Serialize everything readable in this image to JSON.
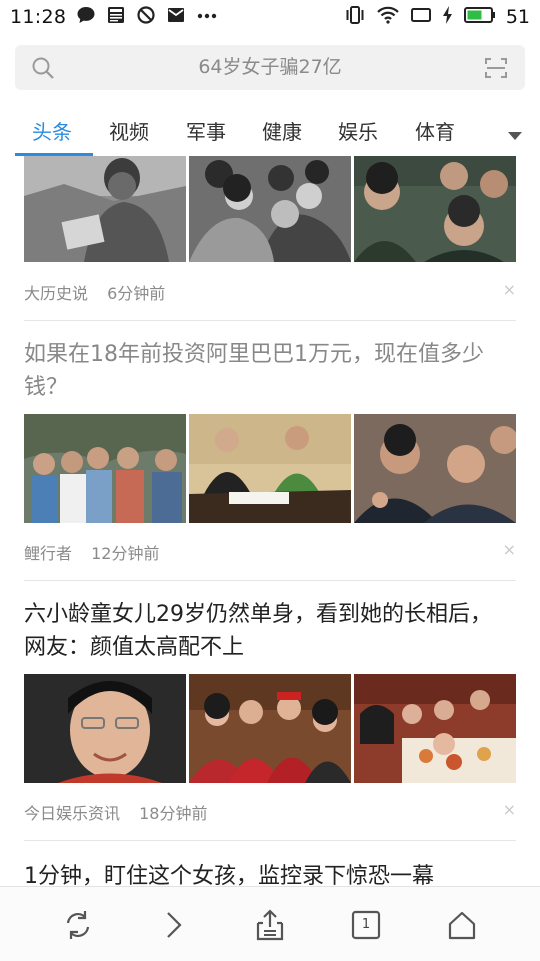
{
  "status_bar": {
    "time": "11:28",
    "battery_percent": "51",
    "left_icons": [
      "chat-icon",
      "news-icon",
      "block-icon",
      "mail-icon",
      "more-dots-icon"
    ],
    "right_icons": [
      "vibrate-icon",
      "wifi-icon",
      "screen-rotate-icon",
      "charging-icon",
      "battery-icon"
    ]
  },
  "search": {
    "placeholder": "64岁女子骗27亿"
  },
  "tabs": [
    {
      "label": "头条",
      "active": true
    },
    {
      "label": "视频",
      "active": false
    },
    {
      "label": "军事",
      "active": false
    },
    {
      "label": "健康",
      "active": false
    },
    {
      "label": "娱乐",
      "active": false
    },
    {
      "label": "体育",
      "active": false
    }
  ],
  "feed": [
    {
      "headline": "",
      "source": "大历史说",
      "time": "6分钟前",
      "thumb_style": "black-and-white"
    },
    {
      "headline": "如果在18年前投资阿里巴巴1万元，现在值多少钱？",
      "read": true,
      "source": "鲤行者",
      "time": "12分钟前"
    },
    {
      "headline": "六小龄童女儿29岁仍然单身，看到她的长相后，网友：颜值太高配不上",
      "read": false,
      "source": "今日娱乐资讯",
      "time": "18分钟前"
    },
    {
      "headline": "1分钟，盯住这个女孩，监控录下惊恐一幕",
      "read": false
    }
  ],
  "close_glyph": "×",
  "toolbar": {
    "tab_count": "1",
    "buttons": [
      "refresh-icon",
      "forward-icon",
      "share-icon",
      "tabs-icon",
      "home-icon"
    ]
  },
  "colors": {
    "accent": "#2a8be0",
    "read_text": "#888888",
    "meta_text": "#8b8b8b"
  }
}
